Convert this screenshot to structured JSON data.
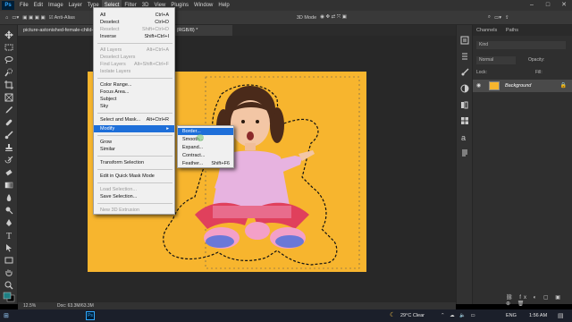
{
  "menubar": {
    "logo": "Ps",
    "items": [
      "File",
      "Edit",
      "Image",
      "Layer",
      "Type",
      "Select",
      "Filter",
      "3D",
      "View",
      "Plugins",
      "Window",
      "Help"
    ],
    "active_index": 5
  },
  "options_bar": {
    "anti_alias": "Anti-Alias",
    "mode_3d": "3D Mode"
  },
  "document": {
    "tab_title": "picture-astonished-female-child-points-aside-wears-...oe.jpg @ 12.5% (RGB/8) *"
  },
  "status": {
    "zoom": "12.5%",
    "doc_size": "Doc: 63.3M/63.3M"
  },
  "panel": {
    "tabs": [
      "Channels",
      "Paths"
    ],
    "kind": "Kind",
    "blend_mode": "Normal",
    "opacity_label": "Opacity:",
    "fill_label": "Fill:",
    "lock_label": "Lock:",
    "layer_name": "Background"
  },
  "select_menu": {
    "items": [
      {
        "label": "All",
        "shortcut": "Ctrl+A",
        "disabled": false
      },
      {
        "label": "Deselect",
        "shortcut": "Ctrl+D",
        "disabled": false
      },
      {
        "label": "Reselect",
        "shortcut": "Shift+Ctrl+D",
        "disabled": true
      },
      {
        "label": "Inverse",
        "shortcut": "Shift+Ctrl+I",
        "disabled": false
      },
      {
        "label": "All Layers",
        "shortcut": "Alt+Ctrl+A",
        "disabled": true
      },
      {
        "label": "Deselect Layers",
        "shortcut": "",
        "disabled": true
      },
      {
        "label": "Find Layers",
        "shortcut": "Alt+Shift+Ctrl+F",
        "disabled": true
      },
      {
        "label": "Isolate Layers",
        "shortcut": "",
        "disabled": true
      },
      {
        "label": "Color Range...",
        "shortcut": "",
        "disabled": false
      },
      {
        "label": "Focus Area...",
        "shortcut": "",
        "disabled": false
      },
      {
        "label": "Subject",
        "shortcut": "",
        "disabled": false
      },
      {
        "label": "Sky",
        "shortcut": "",
        "disabled": false
      },
      {
        "label": "Select and Mask...",
        "shortcut": "Alt+Ctrl+R",
        "disabled": false
      },
      {
        "label": "Modify",
        "shortcut": "",
        "disabled": false
      },
      {
        "label": "Grow",
        "shortcut": "",
        "disabled": false
      },
      {
        "label": "Similar",
        "shortcut": "",
        "disabled": false
      },
      {
        "label": "Transform Selection",
        "shortcut": "",
        "disabled": false
      },
      {
        "label": "Edit in Quick Mask Mode",
        "shortcut": "",
        "disabled": false
      },
      {
        "label": "Load Selection...",
        "shortcut": "",
        "disabled": true
      },
      {
        "label": "Save Selection...",
        "shortcut": "",
        "disabled": false
      },
      {
        "label": "New 3D Extrusion",
        "shortcut": "",
        "disabled": true
      }
    ]
  },
  "modify_submenu": {
    "items": [
      {
        "label": "Border...",
        "shortcut": ""
      },
      {
        "label": "Smooth...",
        "shortcut": ""
      },
      {
        "label": "Expand...",
        "shortcut": ""
      },
      {
        "label": "Contract...",
        "shortcut": ""
      },
      {
        "label": "Feather...",
        "shortcut": "Shift+F6"
      }
    ]
  },
  "taskbar": {
    "weather": "29°C Clear",
    "language": "ENG",
    "time": "1:56 AM"
  },
  "colors": {
    "background_yellow": "#f7b52e",
    "highlight_blue": "#1e6fd9"
  }
}
